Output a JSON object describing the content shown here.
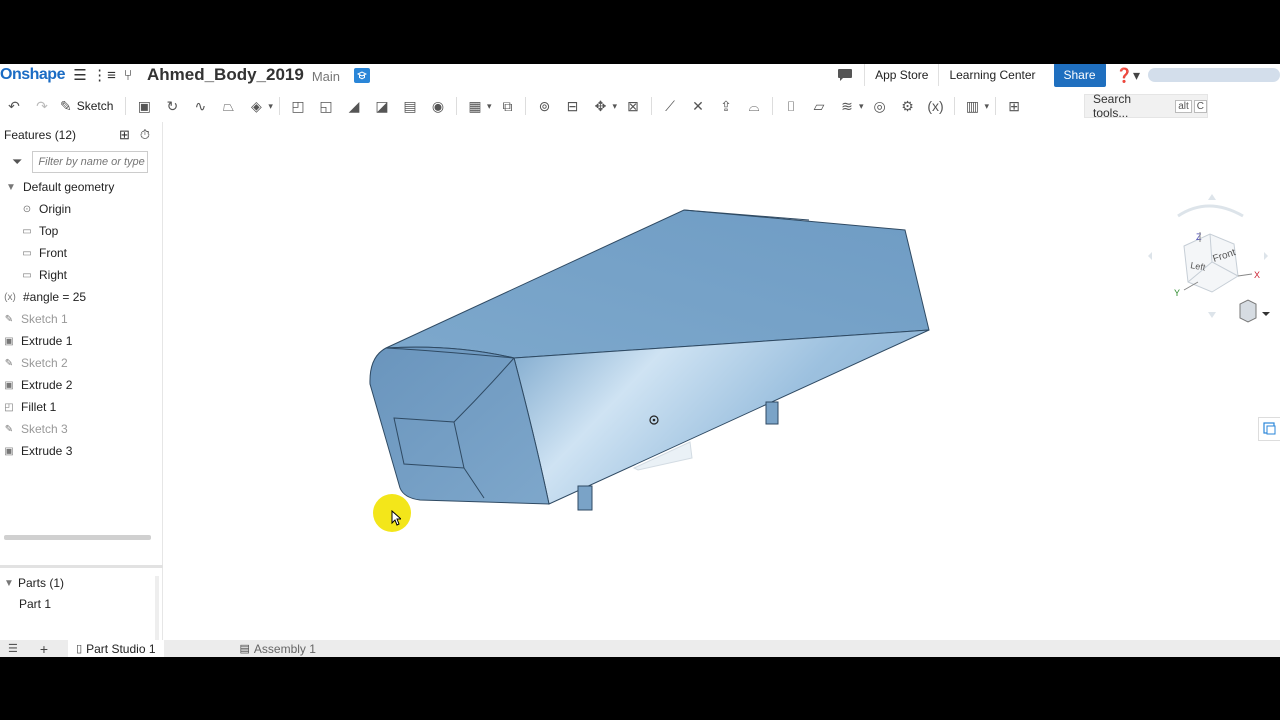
{
  "header": {
    "logo": "Onshape",
    "doc_title": "Ahmed_Body_2019",
    "branch": "Main",
    "app_store": "App Store",
    "learning_center": "Learning Center",
    "share": "Share"
  },
  "toolbar": {
    "sketch_label": "Sketch",
    "search_label": "Search tools...",
    "shortcut_alt": "alt",
    "shortcut_key": "C"
  },
  "features": {
    "header": "Features (12)",
    "filter_placeholder": "Filter by name or type",
    "items": [
      {
        "label": "Default geometry",
        "kind": "group"
      },
      {
        "label": "Origin",
        "kind": "origin"
      },
      {
        "label": "Top",
        "kind": "plane"
      },
      {
        "label": "Front",
        "kind": "plane"
      },
      {
        "label": "Right",
        "kind": "plane"
      },
      {
        "label": "#angle = 25",
        "kind": "variable"
      },
      {
        "label": "Sketch 1",
        "kind": "sketch"
      },
      {
        "label": "Extrude 1",
        "kind": "extrude"
      },
      {
        "label": "Sketch 2",
        "kind": "sketch"
      },
      {
        "label": "Extrude 2",
        "kind": "extrude"
      },
      {
        "label": "Fillet 1",
        "kind": "fillet"
      },
      {
        "label": "Sketch 3",
        "kind": "sketch"
      },
      {
        "label": "Extrude 3",
        "kind": "extrude"
      }
    ]
  },
  "parts": {
    "header": "Parts (1)",
    "items": [
      "Part 1"
    ]
  },
  "viewcube": {
    "faces": [
      "Front",
      "Left"
    ],
    "axes": [
      "Z",
      "X",
      "Y"
    ]
  },
  "bottom_tabs": [
    {
      "label": "Part Studio 1",
      "active": true
    },
    {
      "label": "Assembly 1",
      "active": false
    }
  ],
  "colors": {
    "accent": "#1f6fbf",
    "model_fill": "#8fb6d6",
    "cursor_highlight": "#f3e61a"
  }
}
